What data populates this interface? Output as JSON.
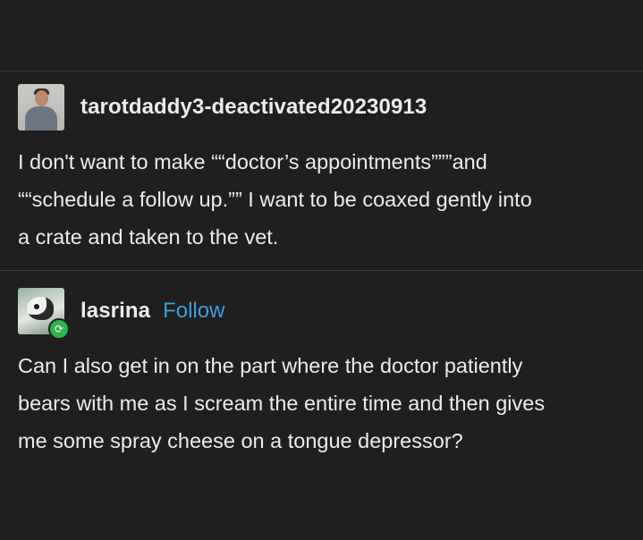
{
  "posts": [
    {
      "username": "tarotdaddy3-deactivated20230913",
      "avatar_icon": "profile-photo-man",
      "text": "I don't want to make ““doctor’s appointments”””and\n““schedule a follow up.”” I want to be coaxed gently into\na crate and taken to the vet."
    },
    {
      "username": "lasrina",
      "follow_label": "Follow",
      "avatar_icon": "profile-photo-animal",
      "badge_icon": "reblog-icon",
      "text": "Can I also get in on the part where the doctor patiently\nbears with me as I scream the entire time and then gives\nme some spray cheese on a tongue depressor?"
    }
  ],
  "colors": {
    "background": "#1f1f1f",
    "text": "#ececec",
    "follow": "#3f9de0",
    "reblog_badge": "#2fb34a",
    "divider": "#3a3a3a"
  }
}
